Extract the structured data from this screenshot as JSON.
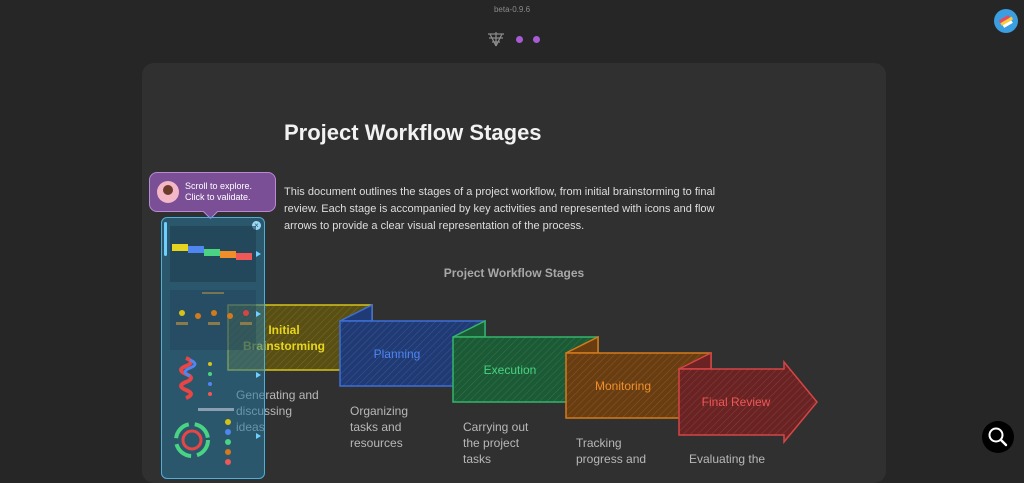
{
  "app": {
    "version": "beta-0.9.6"
  },
  "document": {
    "title": "Project Workflow Stages",
    "description": "This document outlines the stages of a project workflow, from initial brainstorming to final review. Each stage is accompanied by key activities and represented with icons and flow arrows to provide a clear visual representation of the process."
  },
  "diagram": {
    "title": "Project Workflow Stages",
    "stages": [
      {
        "name": "Initial Brainstorming",
        "line1": "Initial",
        "line2": "Brainstorming",
        "caption1": "Generating and",
        "caption2": "discussing",
        "caption3": "ideas",
        "color": "#d4c21a"
      },
      {
        "name": "Planning",
        "caption1": "Organizing",
        "caption2": "tasks and",
        "caption3": "resources",
        "color": "#3d6fd6"
      },
      {
        "name": "Execution",
        "caption1": "Carrying out",
        "caption2": "the project",
        "caption3": "tasks",
        "color": "#34b46a"
      },
      {
        "name": "Monitoring",
        "caption1": "Tracking",
        "caption2": "progress and",
        "color": "#d47a1c"
      },
      {
        "name": "Final Review",
        "caption1": "Evaluating the",
        "color": "#d64545"
      }
    ]
  },
  "tooltip": {
    "line1": "Scroll to explore.",
    "line2": "Click to validate."
  },
  "icons": {
    "logo": "network-icon",
    "profile": "profile-icon",
    "search": "search-icon",
    "close": "close-icon"
  }
}
